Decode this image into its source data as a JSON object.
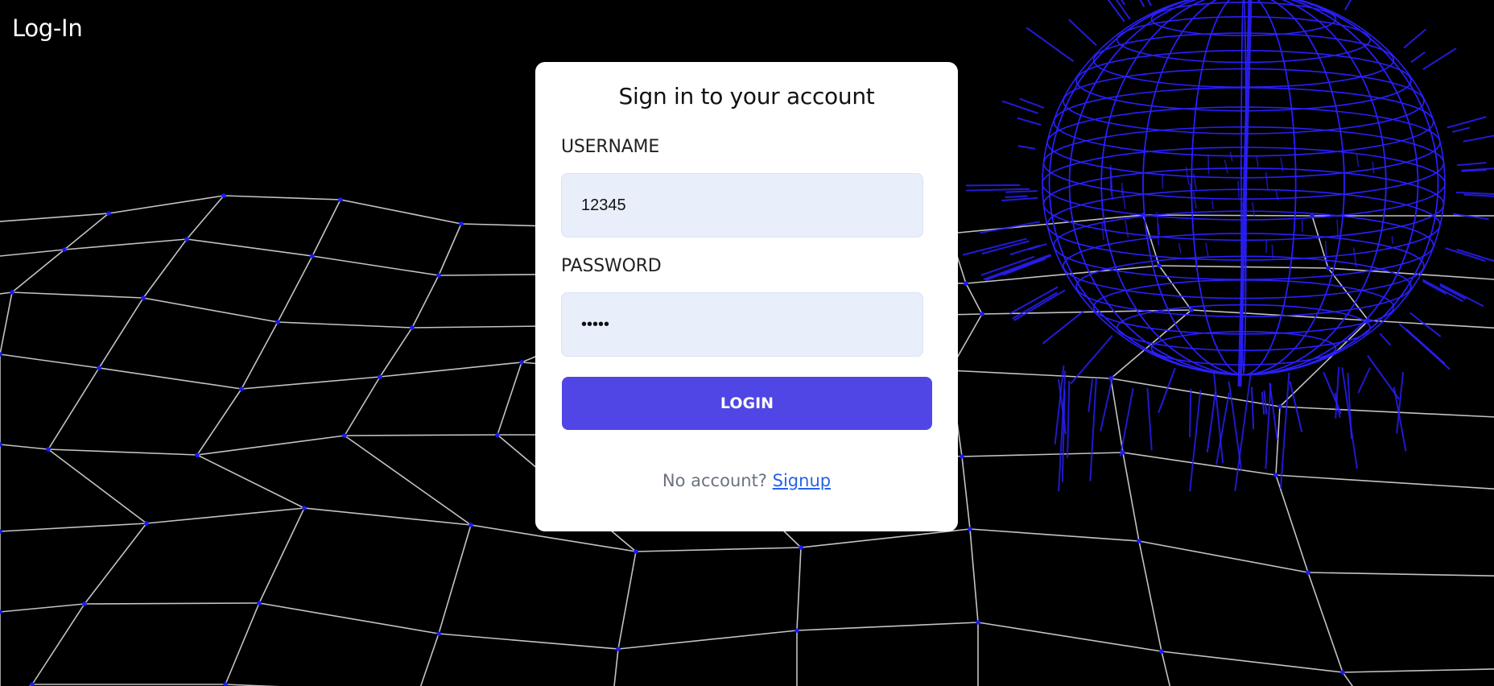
{
  "header": {
    "title": "Log-In"
  },
  "form": {
    "title": "Sign in to your account",
    "username_label": "USERNAME",
    "username_value": "12345",
    "password_label": "PASSWORD",
    "password_value": "12345",
    "login_label": "LOGIN",
    "no_account_text": "No account?",
    "signup_label": "Signup"
  },
  "colors": {
    "background": "#000000",
    "grid_line": "#d9d9d9",
    "grid_node": "#1a1aff",
    "globe": "#2a1fff",
    "accent": "#4f46e5",
    "input_bg": "#e8effb",
    "link": "#2563eb"
  }
}
